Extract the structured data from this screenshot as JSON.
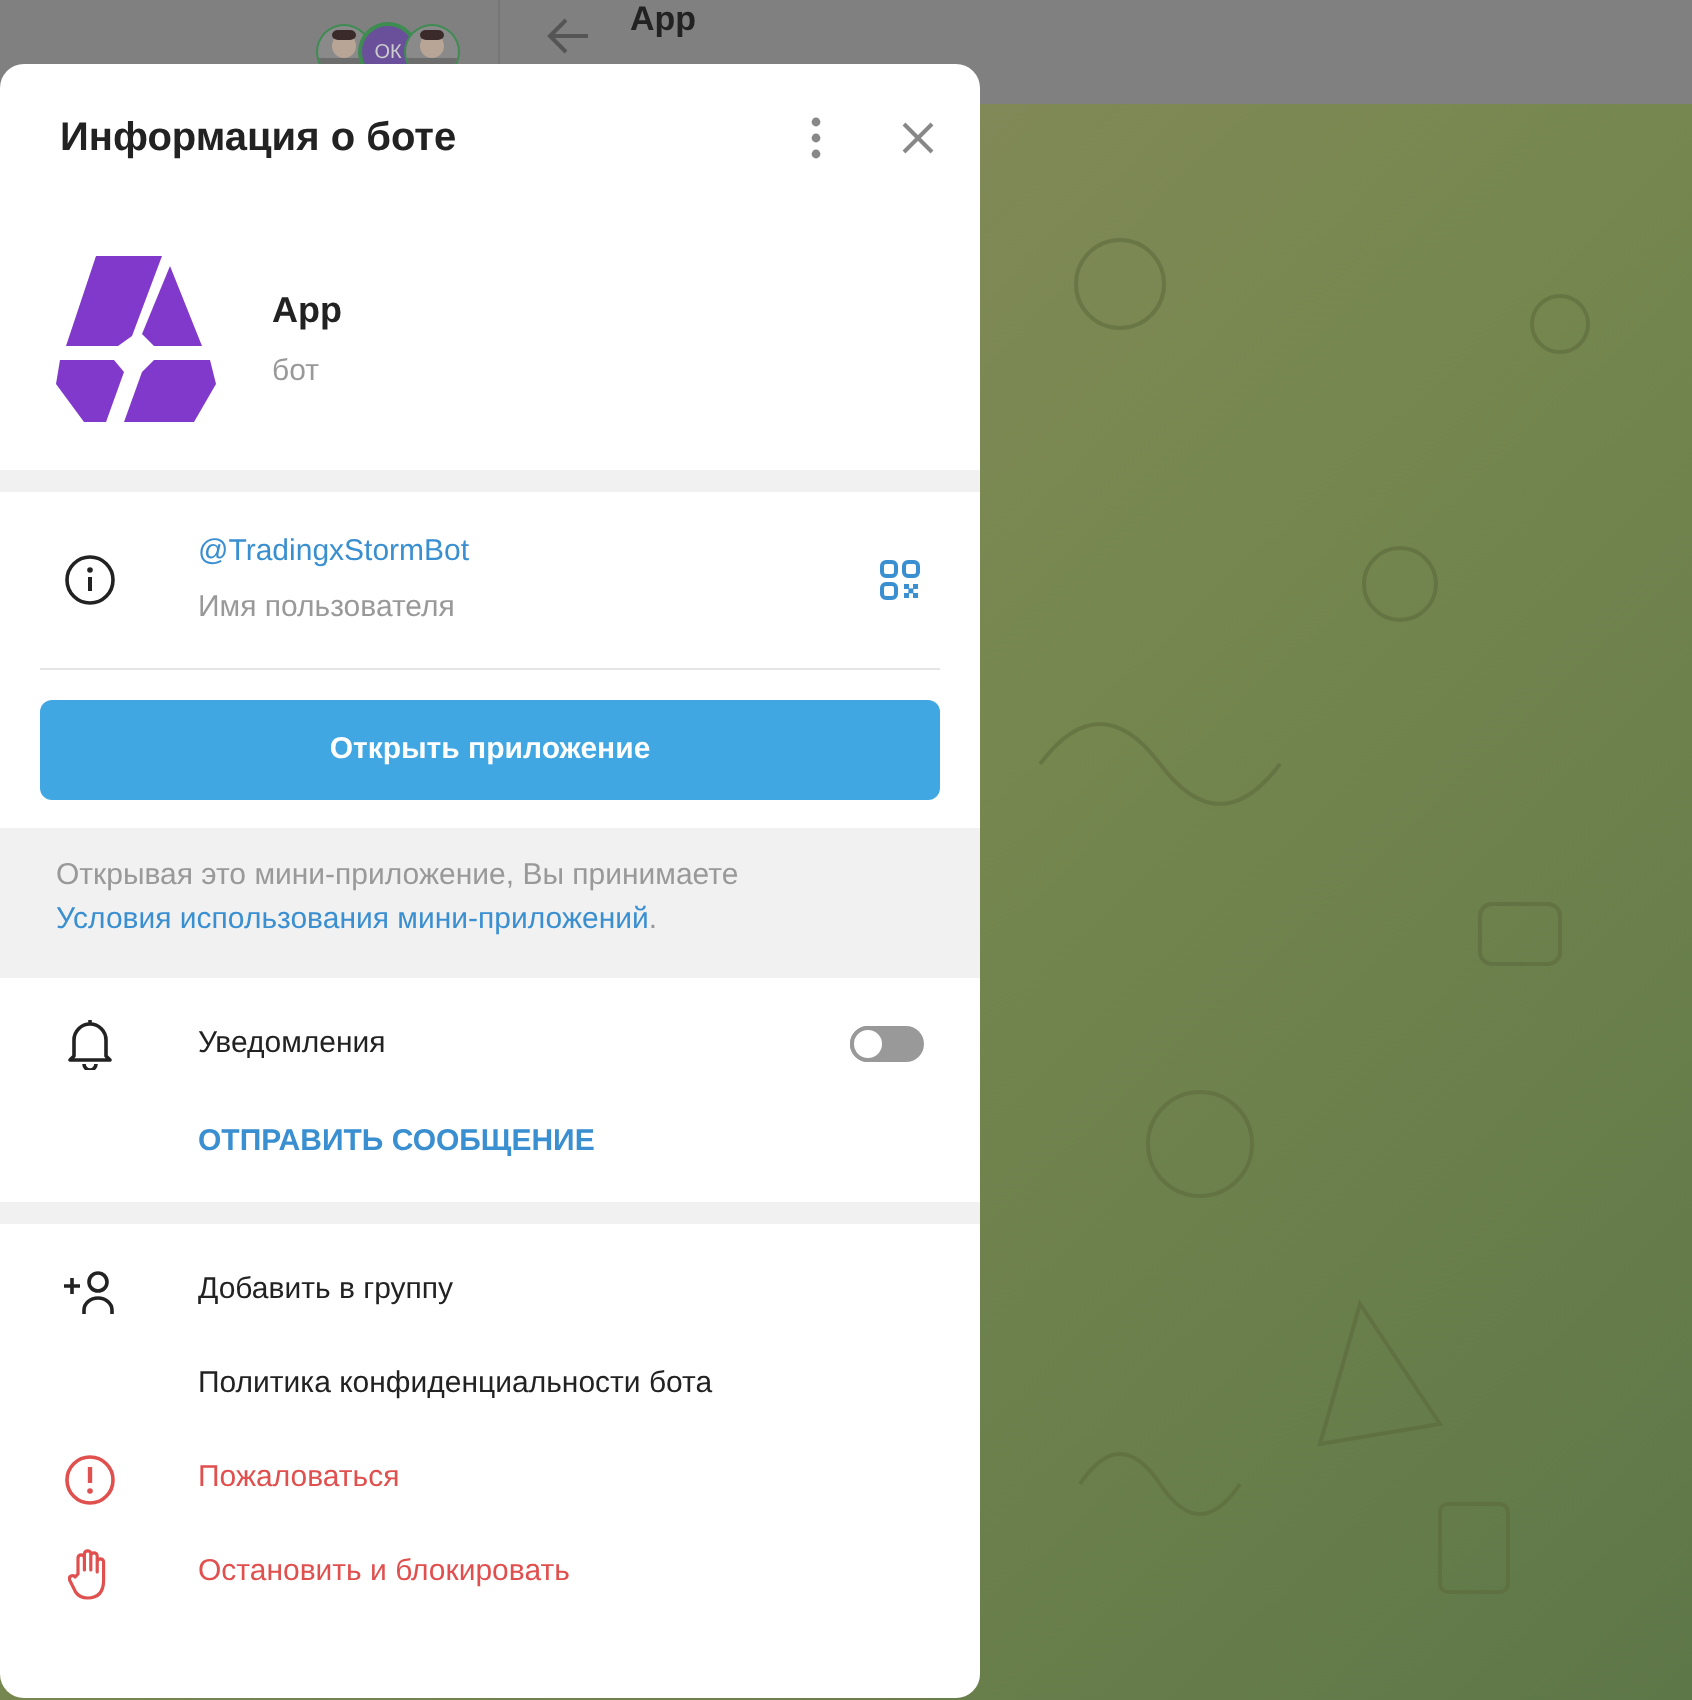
{
  "top_bar": {
    "avatars": [
      {
        "kind": "picture"
      },
      {
        "kind": "initials",
        "text": "ОК"
      },
      {
        "kind": "picture"
      }
    ],
    "title": "App"
  },
  "dialog": {
    "title": "Информация о боте",
    "bot": {
      "name": "App",
      "subtitle": "бот"
    },
    "username": {
      "value": "@TradingxStormBot",
      "label": "Имя пользователя"
    },
    "open_button": "Открыть приложение",
    "notice": {
      "text": "Открывая это мини-приложение, Вы принимаете ",
      "link": "Условия использования мини-приложений",
      "end": "."
    },
    "notifications": {
      "label": "Уведомления",
      "on": false
    },
    "send_message": "ОТПРАВИТЬ СООБЩЕНИЕ",
    "actions": [
      {
        "label": "Добавить в группу",
        "kind": "add-to-group"
      },
      {
        "label": "Политика конфиденциальности бота",
        "kind": "plain"
      },
      {
        "label": "Пожаловаться",
        "kind": "report"
      },
      {
        "label": "Остановить и блокировать",
        "kind": "block"
      }
    ]
  }
}
